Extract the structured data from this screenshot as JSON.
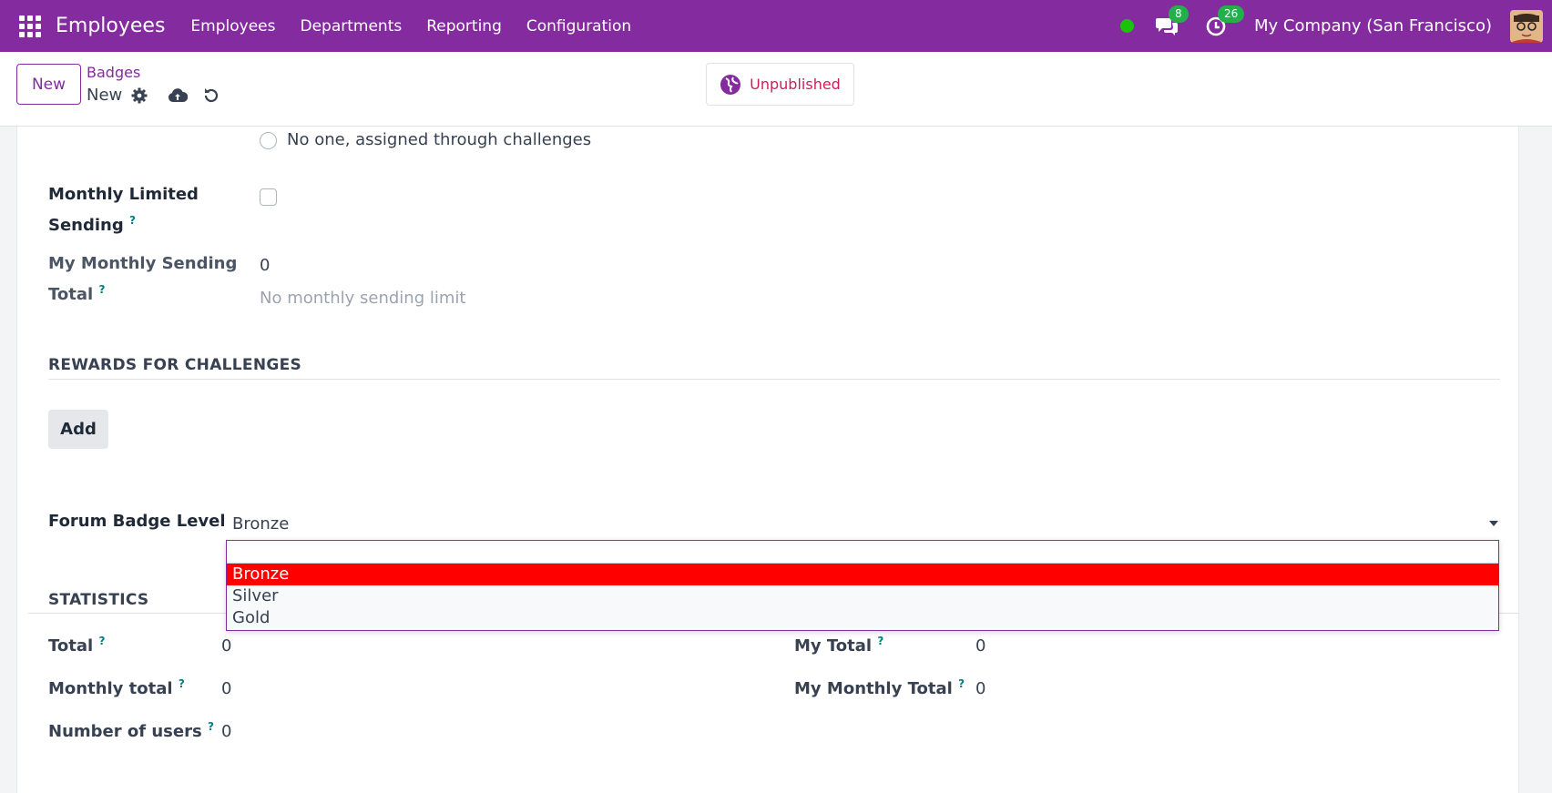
{
  "navbar": {
    "brand": "Employees",
    "menu": [
      "Employees",
      "Departments",
      "Reporting",
      "Configuration"
    ],
    "messages_count": "8",
    "activities_count": "26",
    "company": "My Company (San Francisco)",
    "bg_color": "#842ba0"
  },
  "control": {
    "new_label": "New",
    "breadcrumb": "Badges",
    "record_name": "New",
    "publish_label": "Unpublished"
  },
  "form": {
    "radio_option": "No one, assigned through challenges",
    "monthly_limited_label_1": "Monthly Limited",
    "monthly_limited_label_2": "Sending",
    "my_monthly_sending_label_1": "My Monthly Sending",
    "my_monthly_sending_label_2": "Total",
    "my_monthly_sending_value": "0",
    "no_limit_text": "No monthly sending limit",
    "rewards_section": "REWARDS FOR CHALLENGES",
    "add_label": "Add",
    "forum_badge_label": "Forum Badge Level",
    "forum_badge_value": "Bronze",
    "help_mark": "?"
  },
  "dropdown": {
    "options": [
      "Bronze",
      "Silver",
      "Gold"
    ],
    "selected": "Bronze"
  },
  "statistics": {
    "title": "STATISTICS",
    "total_label": "Total",
    "total_value": "0",
    "monthly_total_label": "Monthly total",
    "monthly_total_value": "0",
    "users_label": "Number of users",
    "users_value": "0",
    "my_total_label": "My Total",
    "my_total_value": "0",
    "my_monthly_total_label": "My Monthly Total",
    "my_monthly_total_value": "0"
  }
}
